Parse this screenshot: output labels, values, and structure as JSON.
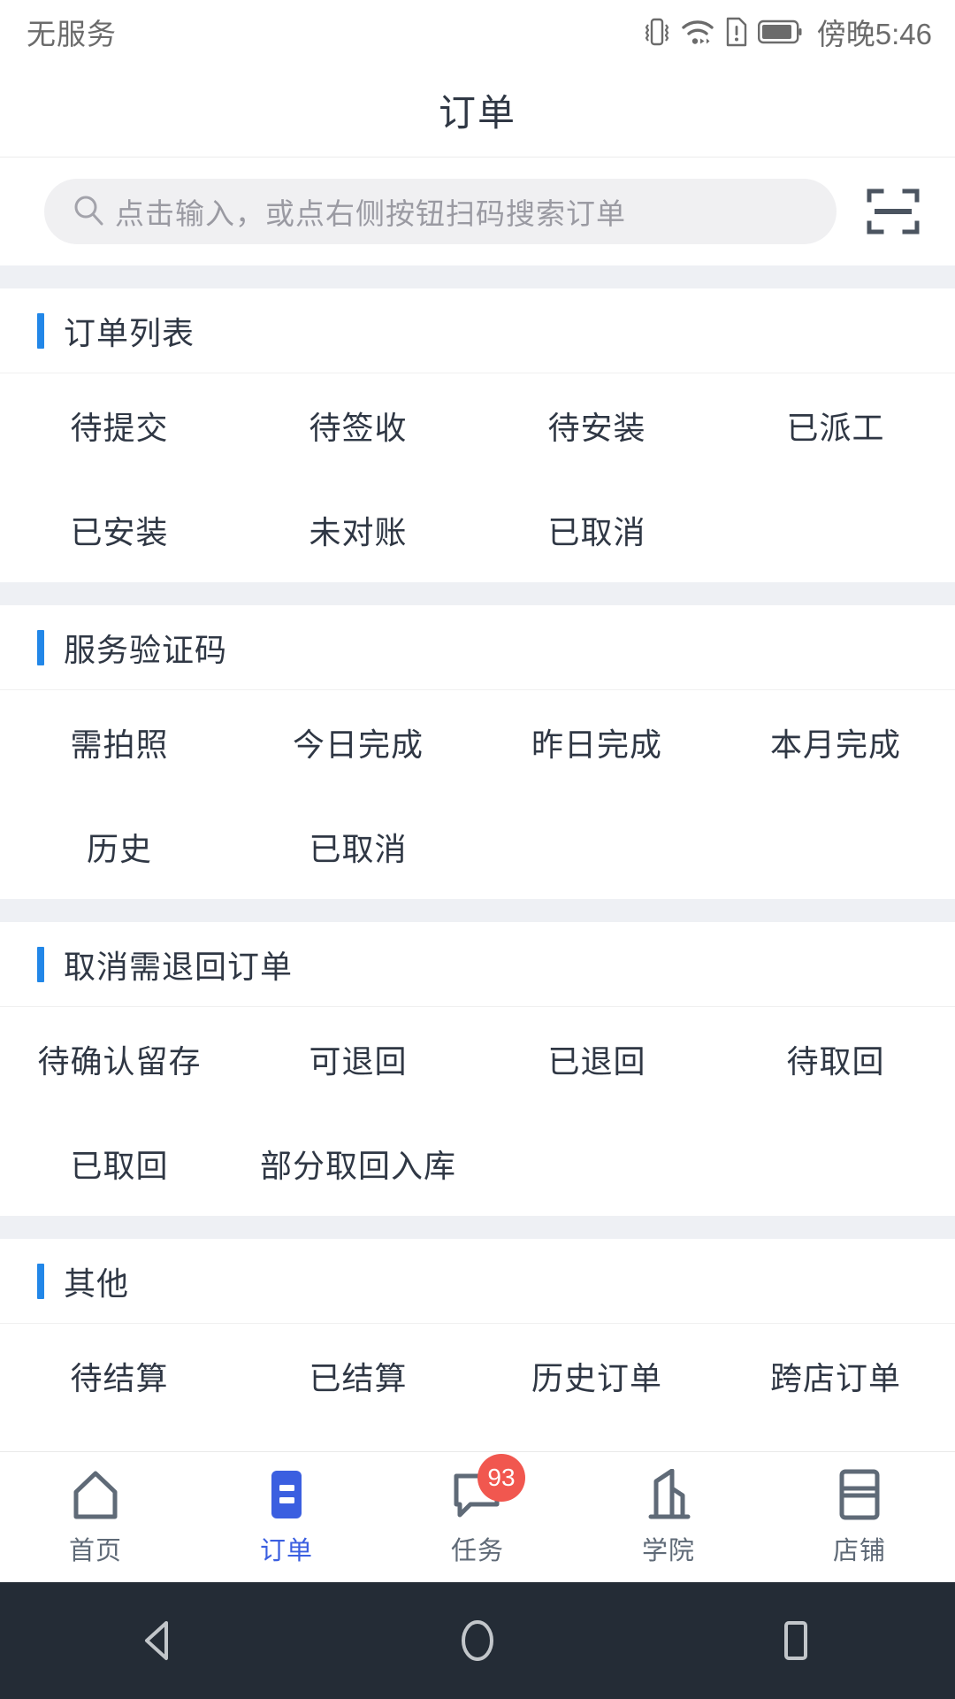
{
  "status_bar": {
    "carrier": "无服务",
    "time": "傍晚5:46",
    "icons": [
      "vibrate-icon",
      "wifi-icon",
      "sim-alert-icon",
      "battery-icon"
    ]
  },
  "header": {
    "title": "订单"
  },
  "search": {
    "placeholder": "点击输入，或点右侧按钮扫码搜索订单",
    "value": "",
    "search_icon": "search-icon",
    "scan_icon": "scan-code-icon"
  },
  "sections": [
    {
      "title": "订单列表",
      "items": [
        "待提交",
        "待签收",
        "待安装",
        "已派工",
        "已安装",
        "未对账",
        "已取消"
      ]
    },
    {
      "title": "服务验证码",
      "items": [
        "需拍照",
        "今日完成",
        "昨日完成",
        "本月完成",
        "历史",
        "已取消"
      ]
    },
    {
      "title": "取消需退回订单",
      "items": [
        "待确认留存",
        "可退回",
        "已退回",
        "待取回",
        "已取回",
        "部分取回入库"
      ]
    },
    {
      "title": "其他",
      "items": [
        "待结算",
        "已结算",
        "历史订单",
        "跨店订单"
      ]
    }
  ],
  "tabbar": {
    "items": [
      {
        "label": "首页",
        "icon": "home-icon",
        "active": false,
        "badge": ""
      },
      {
        "label": "订单",
        "icon": "order-icon",
        "active": true,
        "badge": ""
      },
      {
        "label": "任务",
        "icon": "task-icon",
        "active": false,
        "badge": "93"
      },
      {
        "label": "学院",
        "icon": "academy-icon",
        "active": false,
        "badge": ""
      },
      {
        "label": "店铺",
        "icon": "shop-icon",
        "active": false,
        "badge": ""
      }
    ]
  },
  "android_nav": {
    "back": "back-triangle-icon",
    "home": "home-circle-icon",
    "recents": "recents-square-icon"
  },
  "colors": {
    "accent_blue": "#2287e8",
    "tab_active": "#3b5fe0",
    "badge_red": "#f1574f",
    "text_primary": "#2f3744",
    "text_muted": "#9a9aa2",
    "gap_bg": "#eef0f4",
    "navbar_bg": "#242c36"
  }
}
